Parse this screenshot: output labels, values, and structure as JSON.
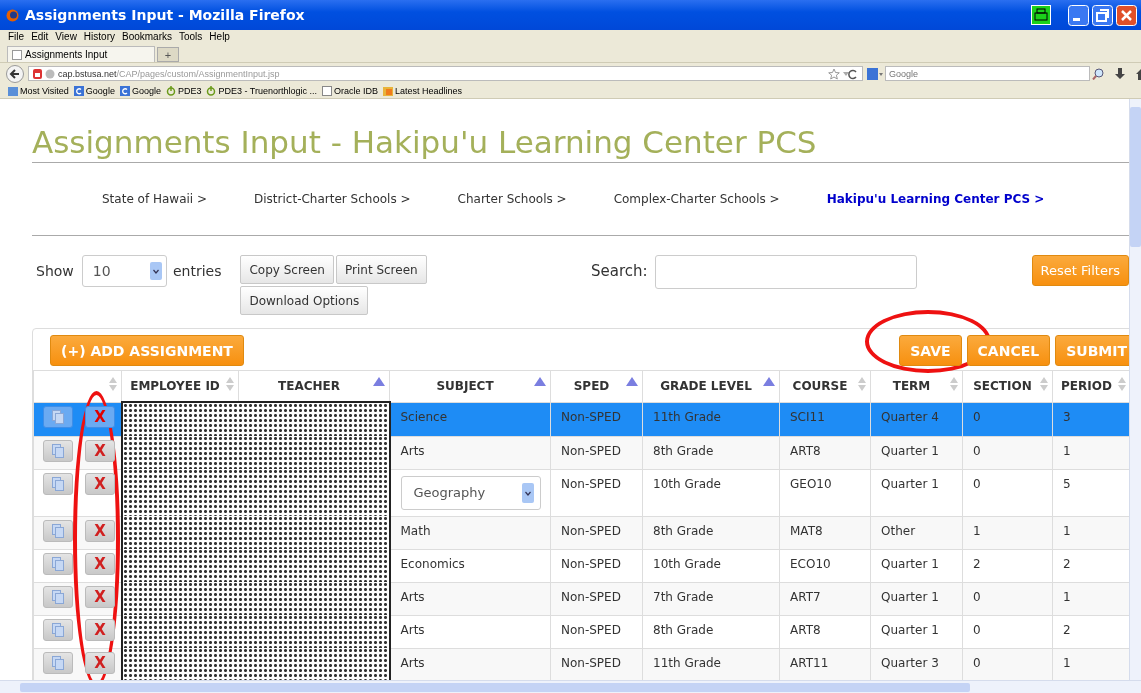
{
  "window": {
    "title": "Assignments Input - Mozilla Firefox"
  },
  "menu": [
    "File",
    "Edit",
    "View",
    "History",
    "Bookmarks",
    "Tools",
    "Help"
  ],
  "tabs": [
    {
      "label": "Assignments Input",
      "selected": true
    }
  ],
  "new_tab": "+",
  "address": {
    "host": "cap.bstusa.net",
    "path": "/CAP/pages/custom/AssignmentInput.jsp"
  },
  "web_search": {
    "placeholder": "Google"
  },
  "bookmarks": [
    {
      "label": "Most Visited",
      "kind": "folder"
    },
    {
      "label": "Google",
      "kind": "google"
    },
    {
      "label": "Google",
      "kind": "google"
    },
    {
      "label": "PDE3",
      "kind": "power"
    },
    {
      "label": "PDE3 - Truenorthlogic ...",
      "kind": "power"
    },
    {
      "label": "Oracle IDB",
      "kind": "page"
    },
    {
      "label": "Latest Headlines",
      "kind": "feed"
    }
  ],
  "page": {
    "heading": "Assignments Input - Hakipu'u Learning Center PCS",
    "breadcrumb": [
      {
        "label": "State of Hawaii >",
        "selected": false
      },
      {
        "label": "District-Charter Schools >",
        "selected": false
      },
      {
        "label": "Charter Schools >",
        "selected": false
      },
      {
        "label": "Complex-Charter Schools >",
        "selected": false
      },
      {
        "label": "Hakipu'u Learning Center PCS >",
        "selected": true
      }
    ],
    "show_label": "Show",
    "entries_value": "10",
    "entries_label": "entries",
    "tool_buttons": [
      "Copy Screen",
      "Print Screen",
      "Download Options"
    ],
    "search_label": "Search:",
    "reset_button": "Reset Filters",
    "add_button": "(+) ADD ASSIGNMENT",
    "action_buttons": [
      {
        "label": "SAVE",
        "circled": true
      },
      {
        "label": "CANCEL",
        "circled": false
      },
      {
        "label": "SUBMIT",
        "circled": false
      }
    ],
    "delete_column_circled": true,
    "columns": [
      {
        "sorted_ascending": false
      },
      {
        "label": "EMPLOYEE ID",
        "sorted_ascending": false
      },
      {
        "label": "TEACHER",
        "sorted_ascending": true
      },
      {
        "label": "SUBJECT",
        "sorted_ascending": true
      },
      {
        "label": "SPED",
        "sorted_ascending": true
      },
      {
        "label": "GRADE LEVEL",
        "sorted_ascending": true
      },
      {
        "label": "COURSE",
        "sorted_ascending": false
      },
      {
        "label": "TERM",
        "sorted_ascending": false
      },
      {
        "label": "SECTION",
        "sorted_ascending": false
      },
      {
        "label": "PERIOD",
        "sorted_ascending": false
      }
    ],
    "rows": [
      {
        "selected": true,
        "delete": "X",
        "subject": {
          "kind": "text",
          "value": "Science"
        },
        "sped": "Non-SPED",
        "grade": "11th Grade",
        "course": "SCI11",
        "term": "Quarter 4",
        "section": "0",
        "period": "3"
      },
      {
        "selected": false,
        "delete": "X",
        "subject": {
          "kind": "text",
          "value": "Arts"
        },
        "sped": "Non-SPED",
        "grade": "8th Grade",
        "course": "ART8",
        "term": "Quarter 1",
        "section": "0",
        "period": "1"
      },
      {
        "selected": false,
        "delete": "X",
        "subject": {
          "kind": "select",
          "value": "Geography"
        },
        "sped": "Non-SPED",
        "grade": "10th Grade",
        "course": "GEO10",
        "term": "Quarter 1",
        "section": "0",
        "period": "5"
      },
      {
        "selected": false,
        "delete": "X",
        "subject": {
          "kind": "text",
          "value": "Math"
        },
        "sped": "Non-SPED",
        "grade": "8th Grade",
        "course": "MAT8",
        "term": "Other",
        "section": "1",
        "period": "1"
      },
      {
        "selected": false,
        "delete": "X",
        "subject": {
          "kind": "text",
          "value": "Economics"
        },
        "sped": "Non-SPED",
        "grade": "10th Grade",
        "course": "ECO10",
        "term": "Quarter 1",
        "section": "2",
        "period": "2"
      },
      {
        "selected": false,
        "delete": "X",
        "subject": {
          "kind": "text",
          "value": "Arts"
        },
        "sped": "Non-SPED",
        "grade": "7th Grade",
        "course": "ART7",
        "term": "Quarter 1",
        "section": "0",
        "period": "1"
      },
      {
        "selected": false,
        "delete": "X",
        "subject": {
          "kind": "text",
          "value": "Arts"
        },
        "sped": "Non-SPED",
        "grade": "8th Grade",
        "course": "ART8",
        "term": "Quarter 1",
        "section": "0",
        "period": "2"
      },
      {
        "selected": false,
        "delete": "X",
        "subject": {
          "kind": "text",
          "value": "Arts"
        },
        "sped": "Non-SPED",
        "grade": "11th Grade",
        "course": "ART11",
        "term": "Quarter 3",
        "section": "0",
        "period": "1"
      }
    ]
  }
}
